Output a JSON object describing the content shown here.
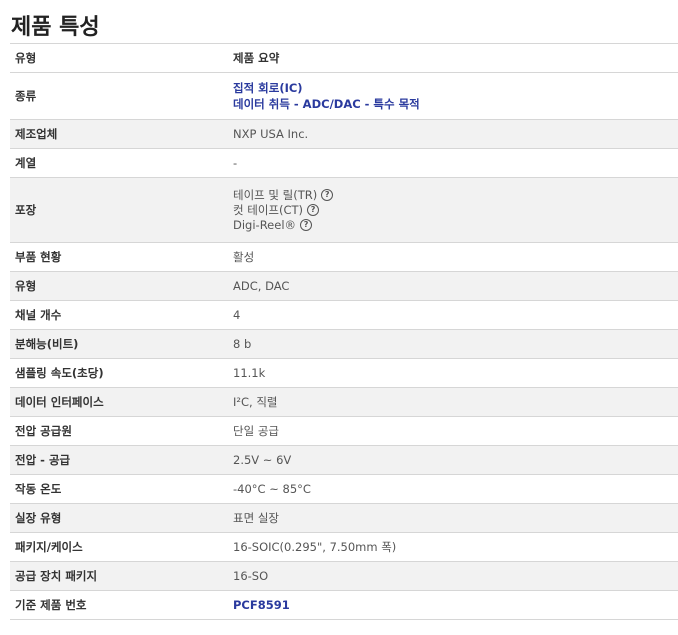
{
  "page_title": "제품 특성",
  "header": {
    "col1": "유형",
    "col2": "제품 요약"
  },
  "rows": [
    {
      "label": "종류",
      "links": [
        "집적 회로(IC)",
        "데이터 취득 - ADC/DAC - 특수 목적"
      ]
    },
    {
      "label": "제조업체",
      "value": "NXP USA Inc."
    },
    {
      "label": "계열",
      "value": "-"
    },
    {
      "label": "포장",
      "packaging": [
        "테이프 및 릴(TR)",
        "컷 테이프(CT)",
        "Digi-Reel®"
      ]
    },
    {
      "label": "부품 현황",
      "value": "활성"
    },
    {
      "label": "유형",
      "value": "ADC, DAC"
    },
    {
      "label": "채널 개수",
      "value": "4"
    },
    {
      "label": "분해능(비트)",
      "value": "8 b"
    },
    {
      "label": "샘플링 속도(초당)",
      "value": "11.1k"
    },
    {
      "label": "데이터 인터페이스",
      "value": "I²C, 직렬"
    },
    {
      "label": "전압 공급원",
      "value": "단일 공급"
    },
    {
      "label": "전압 - 공급",
      "value": "2.5V ~ 6V"
    },
    {
      "label": "작동 온도",
      "value": "-40°C ~ 85°C"
    },
    {
      "label": "실장 유형",
      "value": "표면 실장"
    },
    {
      "label": "패키지/케이스",
      "value": "16-SOIC(0.295\", 7.50mm 폭)"
    },
    {
      "label": "공급 장치 패키지",
      "value": "16-SO"
    },
    {
      "label": "기준 제품 번호",
      "value": "PCF8591"
    }
  ],
  "help_glyph": "?",
  "icons": {
    "help": "question-circle-icon"
  },
  "colors": {
    "link": "#2a3a9e",
    "row_alt": "#f2f2f2",
    "border": "#d6d6d6"
  }
}
